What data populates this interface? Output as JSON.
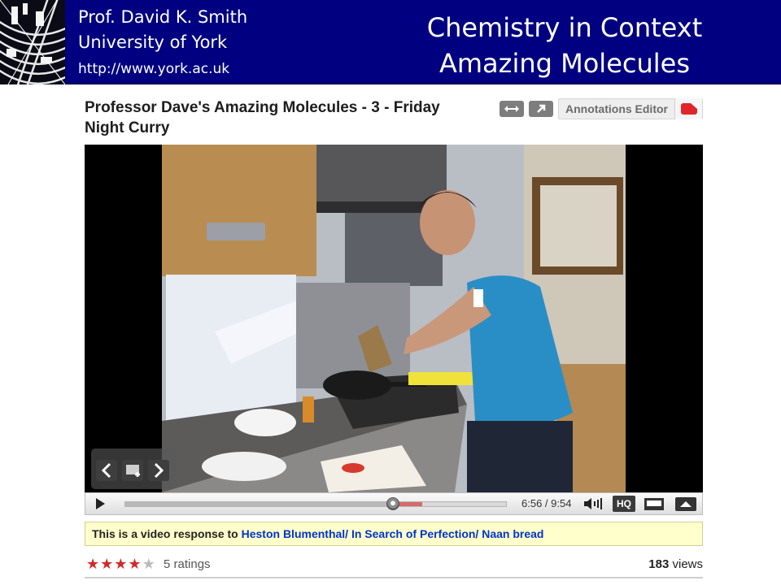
{
  "header": {
    "author_line1": "Prof. David K. Smith",
    "author_line2": "University of York",
    "url": "http://www.york.ac.uk",
    "course_line1": "Chemistry in Context",
    "course_line2": "Amazing Molecules",
    "background_color": "#000080"
  },
  "video": {
    "title": "Professor Dave's Amazing Molecules - 3 - Friday Night Curry",
    "annotations_label": "Annotations Editor",
    "tools": [
      "expand-icon",
      "share-arrow-icon",
      "annotations-icon"
    ]
  },
  "player": {
    "overlay_buttons": [
      "previous-icon",
      "add-to-playlist-icon",
      "next-icon"
    ],
    "time_current": "6:56",
    "time_total": "9:54",
    "time_display": "6:56 / 9:54",
    "progress_fraction": 0.7,
    "hq_label": "HQ"
  },
  "response": {
    "prefix": "This is a video response to ",
    "link_text": "Heston Blumenthal/ In Search of Perfection/ Naan bread"
  },
  "stats": {
    "stars_filled": 4,
    "stars_total": 5,
    "ratings_text": "5 ratings",
    "views_count": "183",
    "views_suffix": " views"
  },
  "colors": {
    "header_bg": "#000080",
    "star": "#d02a2a",
    "link": "#0033cc",
    "response_bg": "#ffffcc"
  }
}
